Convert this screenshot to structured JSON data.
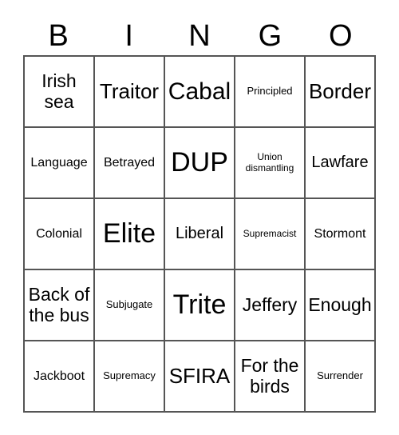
{
  "card": {
    "title": "BINGO",
    "columns": [
      "B",
      "I",
      "N",
      "G",
      "O"
    ],
    "rows": [
      [
        {
          "text": "Irish sea",
          "size": "fs-md"
        },
        {
          "text": "Traitor",
          "size": "fs-lg"
        },
        {
          "text": "Cabal",
          "size": "fs-xl"
        },
        {
          "text": "Principled",
          "size": "fs-xxs"
        },
        {
          "text": "Border",
          "size": "fs-lg"
        }
      ],
      [
        {
          "text": "Language",
          "size": "fs-xs"
        },
        {
          "text": "Betrayed",
          "size": "fs-xs"
        },
        {
          "text": "DUP",
          "size": "fs-xxl"
        },
        {
          "text": "Union dismantling",
          "size": "fs-tiny"
        },
        {
          "text": "Lawfare",
          "size": "fs-sm"
        }
      ],
      [
        {
          "text": "Colonial",
          "size": "fs-xs"
        },
        {
          "text": "Elite",
          "size": "fs-xxl"
        },
        {
          "text": "Liberal",
          "size": "fs-sm"
        },
        {
          "text": "Supremacist",
          "size": "fs-tiny"
        },
        {
          "text": "Stormont",
          "size": "fs-xs"
        }
      ],
      [
        {
          "text": "Back of the bus",
          "size": "fs-md"
        },
        {
          "text": "Subjugate",
          "size": "fs-xxs"
        },
        {
          "text": "Trite",
          "size": "fs-xxl"
        },
        {
          "text": "Jeffery",
          "size": "fs-md"
        },
        {
          "text": "Enough",
          "size": "fs-md"
        }
      ],
      [
        {
          "text": "Jackboot",
          "size": "fs-xs"
        },
        {
          "text": "Supremacy",
          "size": "fs-xxs"
        },
        {
          "text": "SFIRA",
          "size": "fs-lg"
        },
        {
          "text": "For the birds",
          "size": "fs-md"
        },
        {
          "text": "Surrender",
          "size": "fs-xxs"
        }
      ]
    ]
  },
  "colors": {
    "background": "#ffffff",
    "text": "#000000",
    "grid_line": "#555555"
  }
}
